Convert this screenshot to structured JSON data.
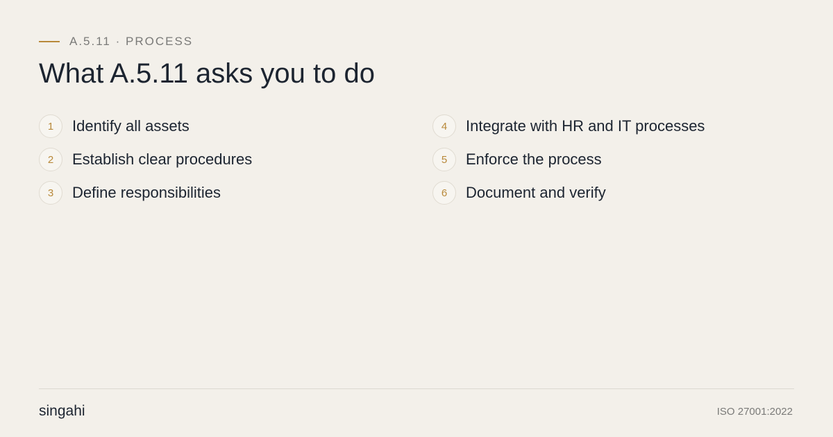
{
  "header": {
    "eyebrow": "A.5.11 · PROCESS",
    "title": "What A.5.11 asks you to do"
  },
  "steps": [
    {
      "number": "1",
      "label": "Identify all assets"
    },
    {
      "number": "2",
      "label": "Establish clear procedures"
    },
    {
      "number": "3",
      "label": "Define responsibilities"
    },
    {
      "number": "4",
      "label": "Integrate with HR and IT processes"
    },
    {
      "number": "5",
      "label": "Enforce the process"
    },
    {
      "number": "6",
      "label": "Document and verify"
    }
  ],
  "footer": {
    "brand": "singahi",
    "standard": "ISO 27001:2022"
  },
  "colors": {
    "background": "#f3f0ea",
    "accent": "#b8893a",
    "text": "#1c2430",
    "muted": "#7a7a78"
  }
}
